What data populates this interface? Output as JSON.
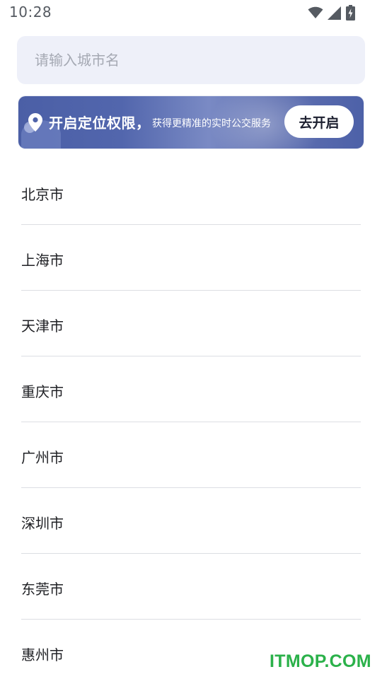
{
  "status_bar": {
    "time": "10:28"
  },
  "search": {
    "placeholder": "请输入城市名",
    "value": ""
  },
  "location_banner": {
    "title": "开启定位权限，",
    "subtitle": "获得更精准的实时公交服务",
    "button_label": "去开启"
  },
  "cities": [
    {
      "name": "北京市"
    },
    {
      "name": "上海市"
    },
    {
      "name": "天津市"
    },
    {
      "name": "重庆市"
    },
    {
      "name": "广州市"
    },
    {
      "name": "深圳市"
    },
    {
      "name": "东莞市"
    },
    {
      "name": "惠州市"
    }
  ],
  "watermark": "ITMOP.COM",
  "colors": {
    "banner_blue": "#4b5fa6",
    "search_bg": "#eef0f9",
    "divider": "#dcdee3",
    "watermark_green": "#2bb14a"
  }
}
